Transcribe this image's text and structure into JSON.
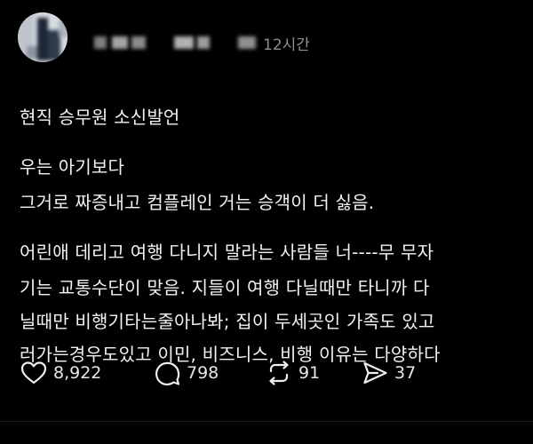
{
  "post": {
    "time": "12시간",
    "paragraphs": [
      [
        "현직 승무원 소신발언"
      ],
      [
        "우는 아기보다",
        "그거로 짜증내고 컴플레인 거는 승객이 더 싫음."
      ],
      [
        "어린애 데리고 여행 다니지 말라는 사람들 너----무 무자",
        "기는 교통수단이 맞음. 지들이 여행 다닐때만 타니까 다",
        "닐때만 비행기타는줄아나봐; 집이 두세곳인 가족도 있고",
        "러가는경우도있고 이민, 비즈니스, 비행 이유는 다양하다"
      ]
    ]
  },
  "actions": {
    "like": {
      "icon": "heart-icon",
      "count": "8,922"
    },
    "comment": {
      "icon": "comment-icon",
      "count": "798"
    },
    "repost": {
      "icon": "repost-icon",
      "count": "91"
    },
    "share": {
      "icon": "send-icon",
      "count": "37"
    }
  }
}
